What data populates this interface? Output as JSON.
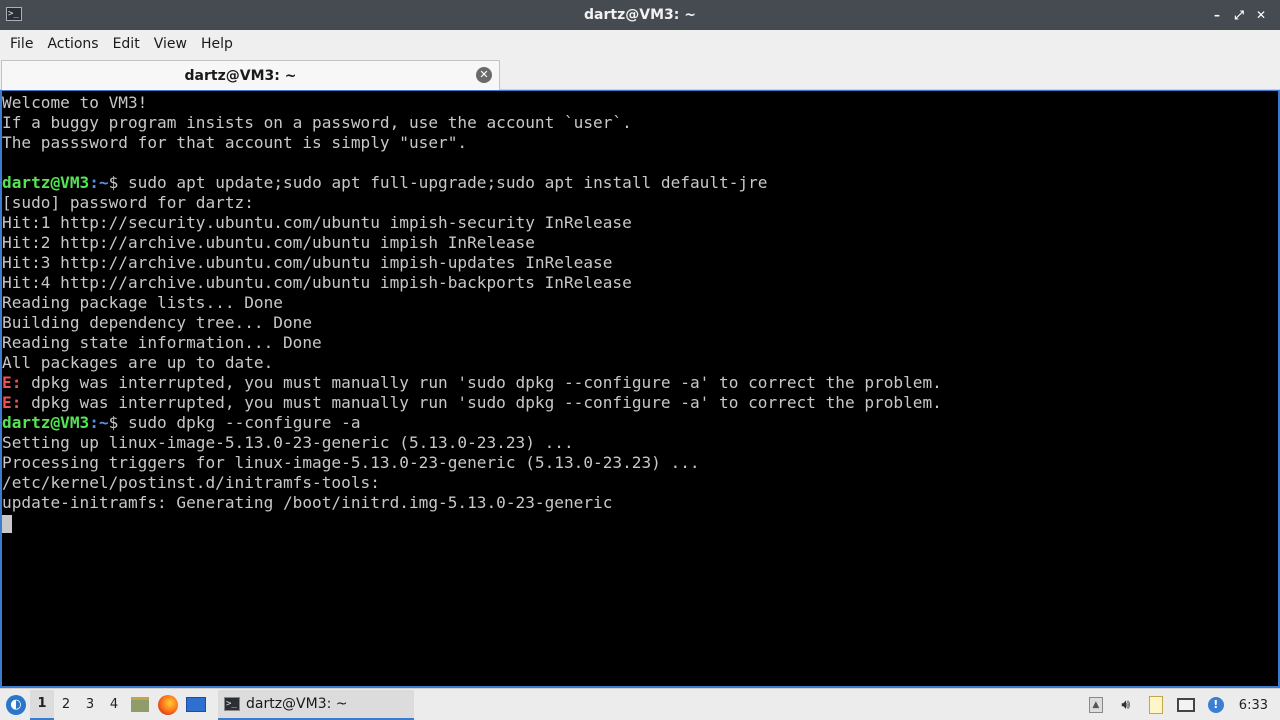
{
  "window": {
    "title": "dartz@VM3: ~",
    "icon": "terminal-icon",
    "controls": {
      "minimize": "–",
      "maximize": "⤢",
      "close": "✕"
    }
  },
  "menu": {
    "items": [
      "File",
      "Actions",
      "Edit",
      "View",
      "Help"
    ]
  },
  "tab": {
    "label": "dartz@VM3: ~",
    "close": "✕"
  },
  "terminal": {
    "lines": [
      {
        "type": "text",
        "text": "Welcome to VM3!"
      },
      {
        "type": "text",
        "text": "If a buggy program insists on a password, use the account `user`."
      },
      {
        "type": "text",
        "text": "The passsword for that account is simply \"user\"."
      },
      {
        "type": "text",
        "text": ""
      },
      {
        "type": "prompt",
        "user": "dartz@VM3",
        "path": ":~",
        "cmd": "$ sudo apt update;sudo apt full-upgrade;sudo apt install default-jre"
      },
      {
        "type": "text",
        "text": "[sudo] password for dartz:"
      },
      {
        "type": "text",
        "text": "Hit:1 http://security.ubuntu.com/ubuntu impish-security InRelease"
      },
      {
        "type": "text",
        "text": "Hit:2 http://archive.ubuntu.com/ubuntu impish InRelease"
      },
      {
        "type": "text",
        "text": "Hit:3 http://archive.ubuntu.com/ubuntu impish-updates InRelease"
      },
      {
        "type": "text",
        "text": "Hit:4 http://archive.ubuntu.com/ubuntu impish-backports InRelease"
      },
      {
        "type": "text",
        "text": "Reading package lists... Done"
      },
      {
        "type": "text",
        "text": "Building dependency tree... Done"
      },
      {
        "type": "text",
        "text": "Reading state information... Done"
      },
      {
        "type": "text",
        "text": "All packages are up to date."
      },
      {
        "type": "error",
        "tag": "E:",
        "text": " dpkg was interrupted, you must manually run 'sudo dpkg --configure -a' to correct the problem."
      },
      {
        "type": "error",
        "tag": "E:",
        "text": " dpkg was interrupted, you must manually run 'sudo dpkg --configure -a' to correct the problem."
      },
      {
        "type": "prompt",
        "user": "dartz@VM3",
        "path": ":~",
        "cmd": "$ sudo dpkg --configure -a"
      },
      {
        "type": "text",
        "text": "Setting up linux-image-5.13.0-23-generic (5.13.0-23.23) ..."
      },
      {
        "type": "text",
        "text": "Processing triggers for linux-image-5.13.0-23-generic (5.13.0-23.23) ..."
      },
      {
        "type": "text",
        "text": "/etc/kernel/postinst.d/initramfs-tools:"
      },
      {
        "type": "text",
        "text": "update-initramfs: Generating /boot/initrd.img-5.13.0-23-generic"
      },
      {
        "type": "cursor"
      }
    ]
  },
  "taskbar": {
    "start_icon": "lubuntu-menu-icon",
    "desktops": [
      "1",
      "2",
      "3",
      "4"
    ],
    "active_desktop": "1",
    "quicklaunch": [
      "file-manager-icon",
      "firefox-icon",
      "show-desktop-icon"
    ],
    "task_label": "dartz@VM3: ~",
    "tray": [
      "removable-media-icon",
      "volume-icon",
      "clipboard-icon",
      "display-icon",
      "update-notifier-icon"
    ],
    "clock": "6:33"
  },
  "colors": {
    "terminal_bg": "#000000",
    "terminal_fg": "#c8c8c8",
    "prompt_user": "#54e454",
    "prompt_path": "#5a8fe8",
    "error": "#f05050",
    "accent": "#3d7bd1"
  }
}
